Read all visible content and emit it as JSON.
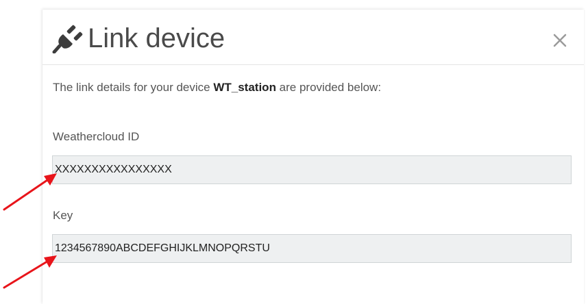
{
  "dialog": {
    "title": "Link device",
    "icon": "plug-icon",
    "close_icon": "close-icon",
    "intro_prefix": "The link details for your device ",
    "device_name": "WT_station",
    "intro_suffix": " are provided below:"
  },
  "fields": {
    "weathercloud_id": {
      "label": "Weathercloud ID",
      "value": "XXXXXXXXXXXXXXXX"
    },
    "key": {
      "label": "Key",
      "value": "1234567890ABCDEFGHIJKLMNOPQRSTU"
    }
  },
  "annotations": {
    "arrow_color": "#e8141a"
  },
  "colors": {
    "input_background": "#eef0f1",
    "title_text": "#4a4a4a"
  }
}
